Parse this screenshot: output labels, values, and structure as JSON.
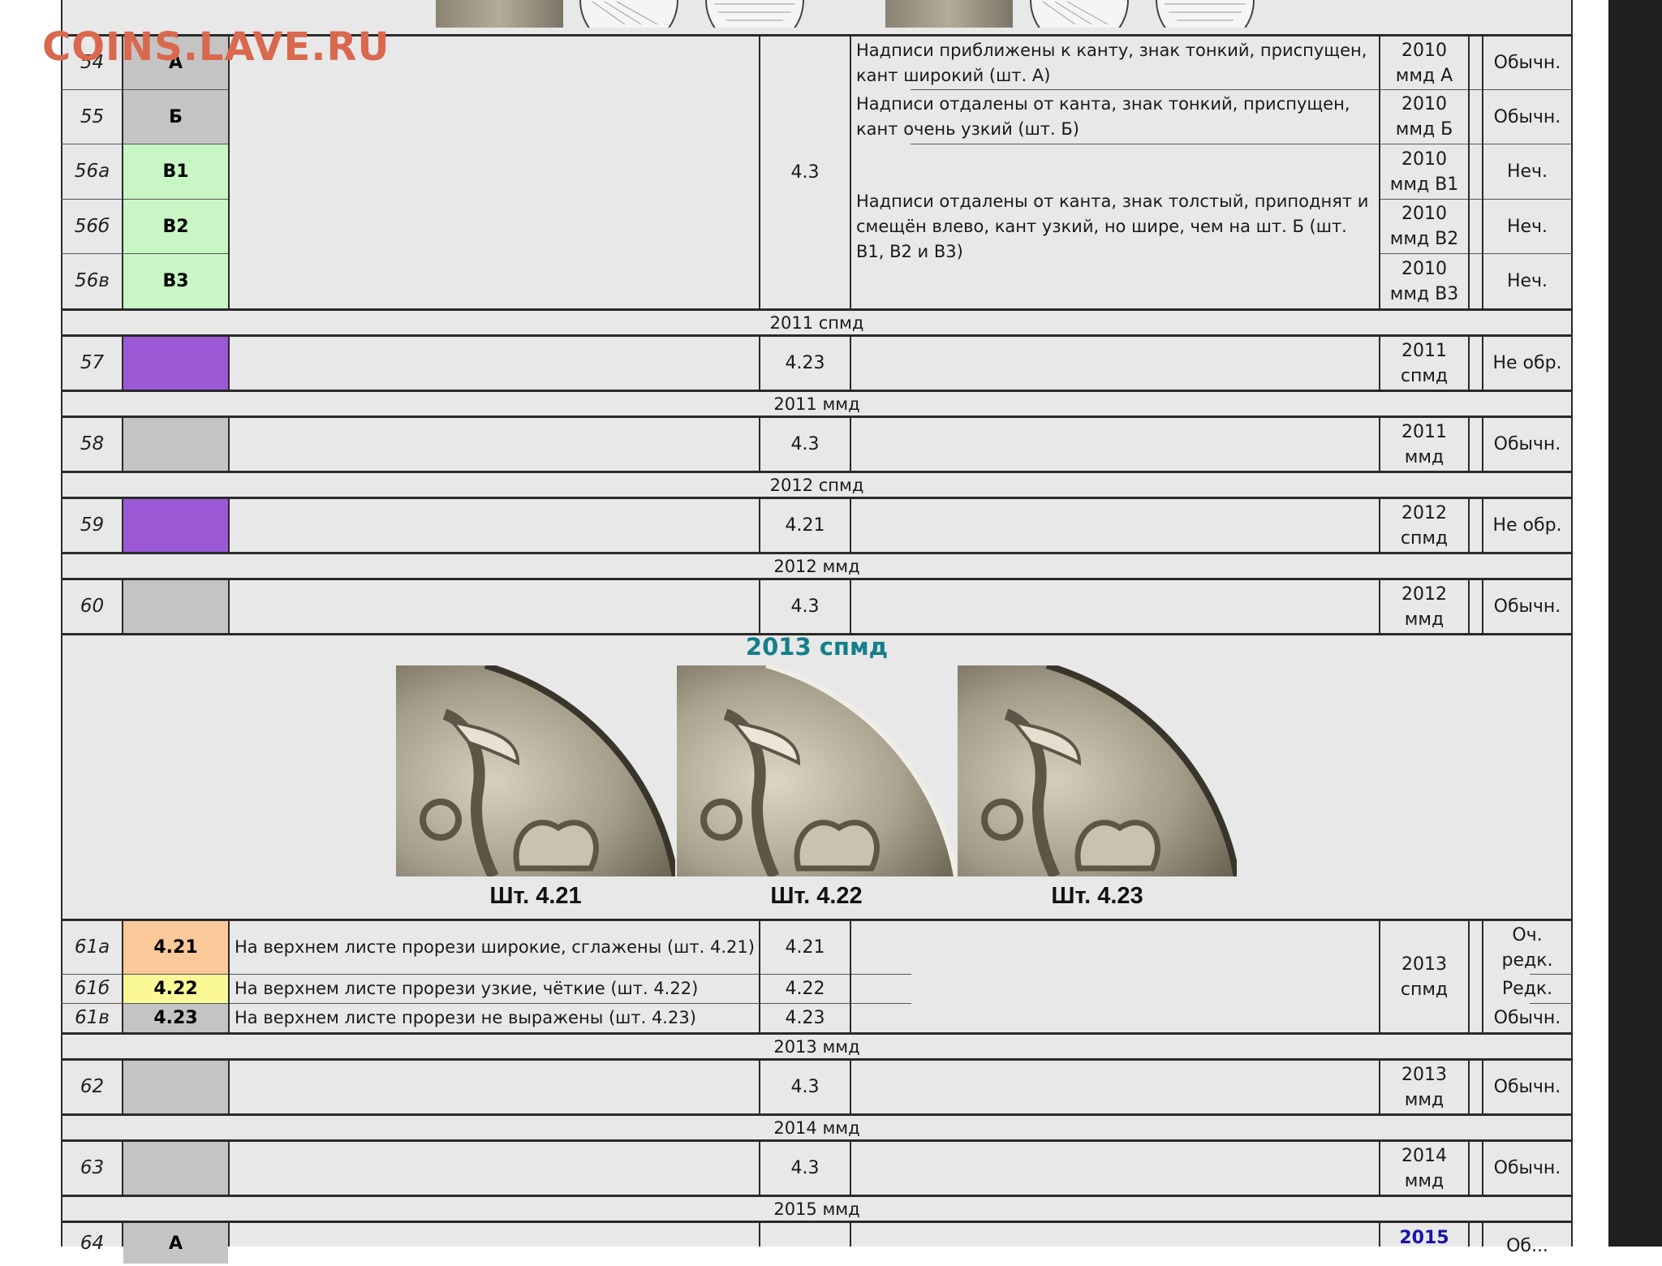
{
  "watermark": "COINS.LAVE.RU",
  "rows": {
    "r54": {
      "num": "54",
      "code": "А",
      "desc": "Надписи приближены к канту, знак тонкий, приспущен, кант широкий (шт. А)",
      "year": "2010",
      "mint": "ммд А",
      "rarity": "Обычн."
    },
    "r55": {
      "num": "55",
      "code": "Б",
      "desc": "Надписи отдалены от канта, знак тонкий, приспущен, кант очень узкий (шт. Б)",
      "year": "2010",
      "mint": "ммд Б",
      "rarity": "Обычн."
    },
    "r56a": {
      "num": "56а",
      "code": "В1",
      "year": "2010",
      "mint": "ммд В1",
      "rarity": "Неч."
    },
    "r56b": {
      "num": "56б",
      "code": "В2",
      "year": "2010",
      "mint": "ммд В2",
      "rarity": "Неч."
    },
    "r56c": {
      "num": "56в",
      "code": "В3",
      "year": "2010",
      "mint": "ммд В3",
      "rarity": "Неч."
    },
    "group56_desc": "Надписи отдалены от канта, знак толстый, приподнят и смещён влево, кант узкий, но шире, чем на шт. Б (шт. В1, В2 и В3)",
    "group54_56_shtamp": "4.3",
    "r57": {
      "num": "57",
      "shtamp": "4.23",
      "year": "2011",
      "mint": "спмд",
      "rarity": "Не обр."
    },
    "r58": {
      "num": "58",
      "shtamp": "4.3",
      "year": "2011",
      "mint": "ммд",
      "rarity": "Обычн."
    },
    "r59": {
      "num": "59",
      "shtamp": "4.21",
      "year": "2012",
      "mint": "спмд",
      "rarity": "Не обр."
    },
    "r60": {
      "num": "60",
      "shtamp": "4.3",
      "year": "2012",
      "mint": "ммд",
      "rarity": "Обычн."
    },
    "r61a": {
      "num": "61а",
      "code": "4.21",
      "desc": "На верхнем листе прорези широкие, сглажены (шт. 4.21)",
      "shtamp": "4.21",
      "rarity1": "Оч.",
      "rarity2": "редк."
    },
    "r61b": {
      "num": "61б",
      "code": "4.22",
      "desc": "На верхнем листе прорези узкие, чёткие (шт. 4.22)",
      "shtamp": "4.22",
      "rarity": "Редк."
    },
    "r61c": {
      "num": "61в",
      "code": "4.23",
      "desc": "На верхнем листе прорези не выражены (шт. 4.23)",
      "shtamp": "4.23",
      "rarity": "Обычн."
    },
    "group61": {
      "year": "2013",
      "mint": "спмд"
    },
    "r62": {
      "num": "62",
      "shtamp": "4.3",
      "year": "2013",
      "mint": "ммд",
      "rarity": "Обычн."
    },
    "r63": {
      "num": "63",
      "shtamp": "4.3",
      "year": "2014",
      "mint": "ммд",
      "rarity": "Обычн."
    },
    "r64": {
      "num": "64",
      "code": "А",
      "year": "2015",
      "rarity": "Об..."
    }
  },
  "sections": {
    "s2011spmd": "2011 спмд",
    "s2011mmd": "2011 ммд",
    "s2012spmd": "2012 спмд",
    "s2012mmd": "2012 ммд",
    "s2013mmd": "2013 ммд",
    "s2014mmd": "2014 ммд",
    "s2015mmd": "2015 ммд"
  },
  "coins": {
    "title": "2013 спмд",
    "captions": [
      "Шт. 4.21",
      "Шт. 4.22",
      "Шт. 4.23"
    ]
  },
  "colors": {
    "grey_code": "#c4c4c4",
    "green_code": "#c8f7c5",
    "purple_code": "#9b59d6",
    "orange_code": "#fcc99a",
    "yellow_code": "#fbf996",
    "title_teal": "#147f8a",
    "watermark": "#d9684f"
  }
}
